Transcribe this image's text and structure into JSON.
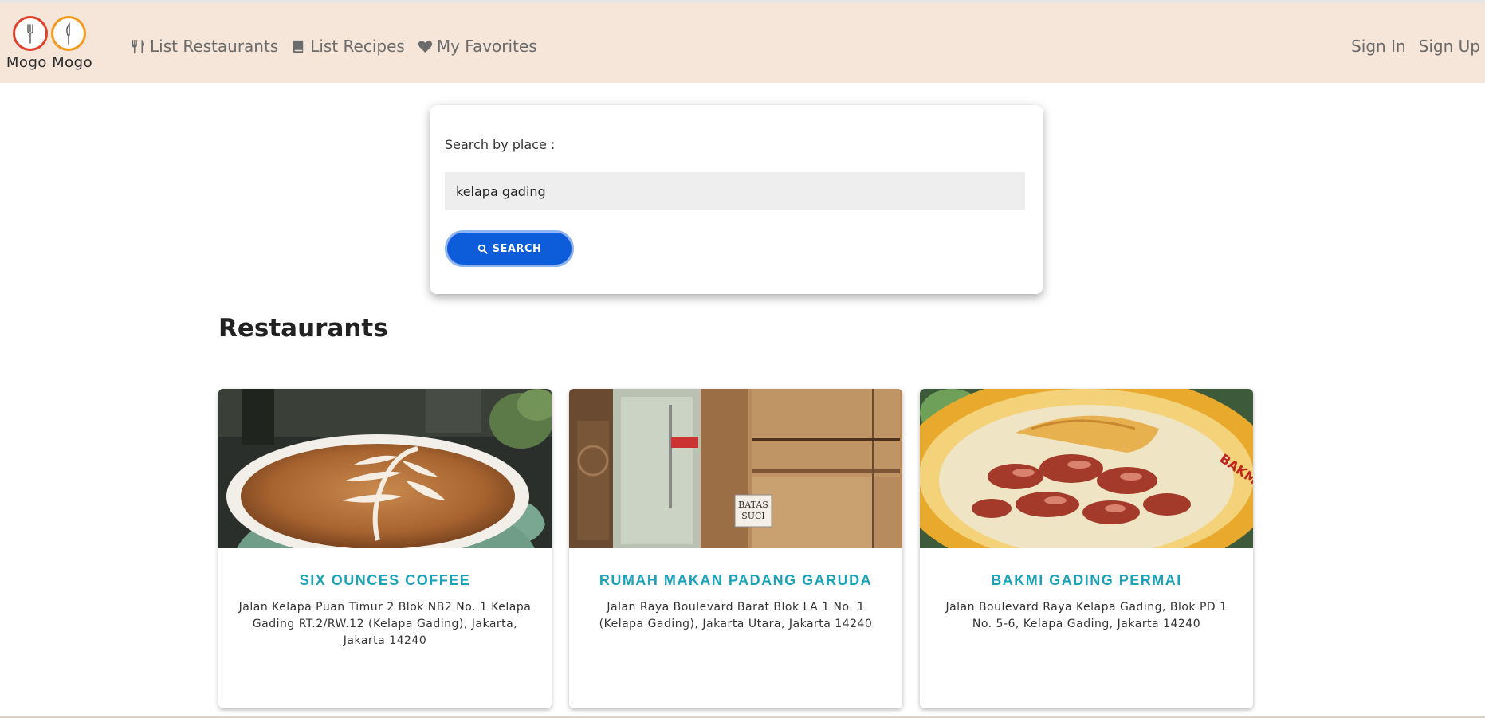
{
  "brand": {
    "name": "Mogo Mogo"
  },
  "nav": {
    "links": [
      {
        "label": "List Restaurants",
        "icon": "utensils-icon"
      },
      {
        "label": "List Recipes",
        "icon": "book-icon"
      },
      {
        "label": "My Favorites",
        "icon": "heart-icon"
      }
    ],
    "auth": {
      "sign_in": "Sign In",
      "sign_up": "Sign Up"
    }
  },
  "search": {
    "label": "Search by place :",
    "value": "kelapa gading",
    "button_label": "SEARCH",
    "button_icon": "search-icon"
  },
  "section": {
    "title": "Restaurants"
  },
  "restaurants": [
    {
      "name": "SIX OUNCES COFFEE",
      "address": "Jalan Kelapa Puan Timur 2 Blok NB2 No. 1 Kelapa Gading RT.2/RW.12 (Kelapa Gading), Jakarta, Jakarta 14240",
      "image": "latte-art-photo"
    },
    {
      "name": "RUMAH MAKAN PADANG GARUDA",
      "address": "Jalan Raya Boulevard Barat Blok LA 1 No. 1 (Kelapa Gading), Jakarta Utara, Jakarta 14240",
      "image": "restaurant-entrance-photo",
      "image_sign_text": "BATAS SUCI"
    },
    {
      "name": "BAKMI GADING PERMAI",
      "address": "Jalan Boulevard Raya Kelapa Gading, Blok PD 1 No. 5-6, Kelapa Gading, Jakarta 14240",
      "image": "noodle-bowl-photo"
    }
  ],
  "colors": {
    "navbar_bg": "#f6e6da",
    "accent_teal": "#1aa3b8",
    "button_blue": "#0d5ddb",
    "logo_red": "#e2402a",
    "logo_orange": "#f39a1c"
  }
}
